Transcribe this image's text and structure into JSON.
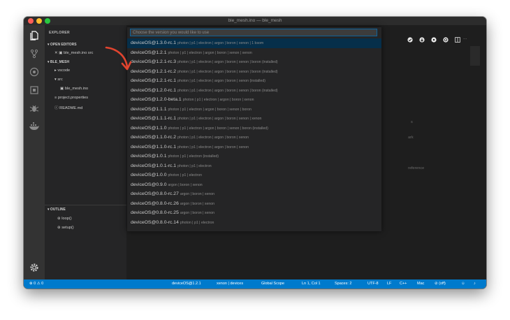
{
  "window": {
    "title": "ble_mesh.ino — ble_mesh",
    "traffic_lights": [
      "#ff5f57",
      "#febc2e",
      "#28c840"
    ]
  },
  "activity_bar": {
    "icons": [
      "files-icon",
      "git-icon",
      "extensions-icon",
      "device-icon",
      "debug-icon",
      "docker-icon",
      "gear-icon"
    ]
  },
  "sidebar": {
    "explorer_label": "EXPLORER",
    "open_editors_label": "OPEN EDITORS",
    "open_editor_file": "ble_mesh.ino  src",
    "project_label": "BLE_MESH",
    "tree": [
      "vscode",
      "src",
      "ble_mesh.ino",
      "project.properties",
      "README.md"
    ],
    "outline_label": "OUTLINE",
    "outline_items": [
      "loop()",
      "setup()"
    ]
  },
  "editor_bg_text": [
    "ark",
    "reference",
    "s"
  ],
  "picker": {
    "placeholder": "Choose the version you would like to use",
    "items": [
      {
        "name": "deviceOS@1.3.0-rc.1",
        "desc": "photon | p1 | electron | argon | boron | xenon | 1 bsom",
        "selected": true
      },
      {
        "name": "deviceOS@1.2.1",
        "desc": "photon | p1 | electron | argon | boron | xenon | xenon"
      },
      {
        "name": "deviceOS@1.2.1-rc.3",
        "desc": "photon | p1 | electron | argon | boron | xenon | boron (installed)"
      },
      {
        "name": "deviceOS@1.2.1-rc.2",
        "desc": "photon | p1 | electron | argon | boron | xenon | boron (installed)"
      },
      {
        "name": "deviceOS@1.2.1-rc.1",
        "desc": "photon | p1 | electron | argon | boron | xenon (installed)"
      },
      {
        "name": "deviceOS@1.2.0-rc.1",
        "desc": "photon | p1 | electron | argon | boron | xenon | boron (installed)"
      },
      {
        "name": "deviceOS@1.2.0-beta.1",
        "desc": "photon | p1 | electron | argon | boron | xenon"
      },
      {
        "name": "deviceOS@1.1.1",
        "desc": "photon | p1 | electron | argon | boron | xenon | boron"
      },
      {
        "name": "deviceOS@1.1.1-rc.1",
        "desc": "photon | p1 | electron | argon | boron | xenon | xenon"
      },
      {
        "name": "deviceOS@1.1.0",
        "desc": "photon | p1 | electron | argon | boron | xenon | boron (installed)"
      },
      {
        "name": "deviceOS@1.1.0-rc.2",
        "desc": "photon | p1 | electron | argon | boron | xenon"
      },
      {
        "name": "deviceOS@1.1.0-rc.1",
        "desc": "photon | p1 | electron | argon | boron | xenon"
      },
      {
        "name": "deviceOS@1.0.1",
        "desc": "photon | p1 | electron (installed)"
      },
      {
        "name": "deviceOS@1.0.1-rc.1",
        "desc": "photon | p1 | electron"
      },
      {
        "name": "deviceOS@1.0.0",
        "desc": "photon | p1 | electron"
      },
      {
        "name": "deviceOS@0.9.0",
        "desc": "argon | boron | xenon"
      },
      {
        "name": "deviceOS@0.8.0-rc.27",
        "desc": "argon | boron | xenon"
      },
      {
        "name": "deviceOS@0.8.0-rc.26",
        "desc": "argon | boron | xenon"
      },
      {
        "name": "deviceOS@0.8.0-rc.25",
        "desc": "argon | boron | xenon"
      },
      {
        "name": "deviceOS@0.8.0-rc.14",
        "desc": "photon | p1 | electron"
      }
    ]
  },
  "status_bar": {
    "problems": "⊗ 0  ⚠ 0",
    "device_os": "deviceOS@1.2.1",
    "devices": "xenon | devices",
    "cloud": "Global Scope",
    "position": "Ln 1, Col 1",
    "spaces": "Spaces: 2",
    "encoding": "UTF-8",
    "eol": "LF",
    "language": "C++",
    "platform": "Mac",
    "particle": "⊘ (off)"
  },
  "colors": {
    "accent": "#007acc",
    "selected_row": "#062f4a",
    "arrow": "#e0442f"
  }
}
